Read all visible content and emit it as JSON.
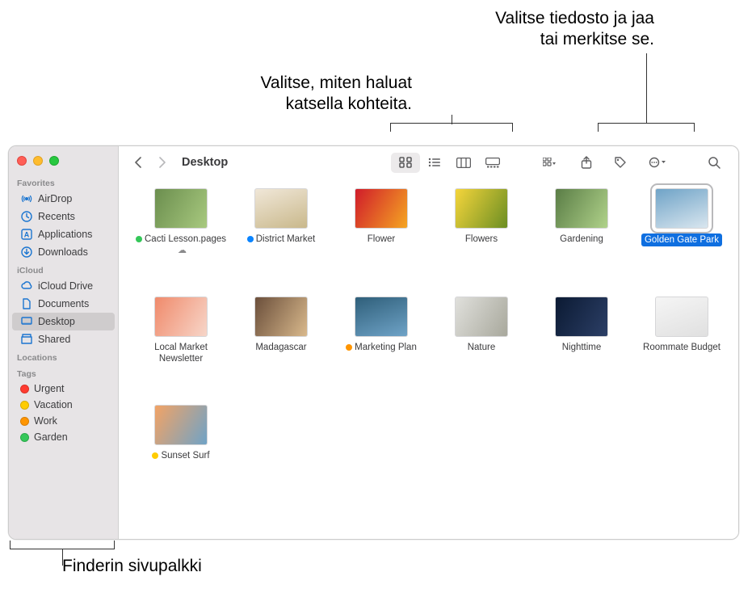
{
  "annotations": {
    "topRight1": "Valitse tiedosto ja jaa",
    "topRight2": "tai merkitse se.",
    "midLeft1": "Valitse, miten haluat",
    "midLeft2": "katsella kohteita.",
    "bottom": "Finderin sivupalkki"
  },
  "window": {
    "title": "Desktop"
  },
  "sidebar": {
    "sections": [
      {
        "header": "Favorites",
        "items": [
          {
            "label": "AirDrop",
            "icon": "airdrop"
          },
          {
            "label": "Recents",
            "icon": "clock"
          },
          {
            "label": "Applications",
            "icon": "apps"
          },
          {
            "label": "Downloads",
            "icon": "download"
          }
        ]
      },
      {
        "header": "iCloud",
        "items": [
          {
            "label": "iCloud Drive",
            "icon": "cloud"
          },
          {
            "label": "Documents",
            "icon": "doc"
          },
          {
            "label": "Desktop",
            "icon": "desktop",
            "selected": true
          },
          {
            "label": "Shared",
            "icon": "shared"
          }
        ]
      },
      {
        "header": "Locations",
        "items": []
      },
      {
        "header": "Tags",
        "items": [
          {
            "label": "Urgent",
            "color": "#ff3b30"
          },
          {
            "label": "Vacation",
            "color": "#ffcc00"
          },
          {
            "label": "Work",
            "color": "#ff9500"
          },
          {
            "label": "Garden",
            "color": "#34c759"
          }
        ]
      }
    ]
  },
  "files": [
    {
      "name": "Cacti Lesson.pages",
      "tag": "#34c759",
      "cloud": true,
      "thumb": "cacti"
    },
    {
      "name": "District Market",
      "tag": "#0a84ff",
      "thumb": "district"
    },
    {
      "name": "Flower",
      "thumb": "flower"
    },
    {
      "name": "Flowers",
      "thumb": "flowers"
    },
    {
      "name": "Gardening",
      "thumb": "gardening"
    },
    {
      "name": "Golden Gate Park",
      "selected": true,
      "thumb": "ggp"
    },
    {
      "name": "Local Market Newsletter",
      "thumb": "local"
    },
    {
      "name": "Madagascar",
      "thumb": "madagascar"
    },
    {
      "name": "Marketing Plan",
      "tag": "#ff9500",
      "thumb": "marketing"
    },
    {
      "name": "Nature",
      "thumb": "nature"
    },
    {
      "name": "Nighttime",
      "thumb": "night"
    },
    {
      "name": "Roommate Budget",
      "thumb": "budget"
    },
    {
      "name": "Sunset Surf",
      "tag": "#ffcc00",
      "thumb": "surf"
    }
  ],
  "thumbs": {
    "cacti": "linear-gradient(120deg,#6b8e4e,#a8c97f)",
    "district": "linear-gradient(160deg,#f0e7d8,#c9b88b)",
    "flower": "linear-gradient(120deg,#d01c2a,#f5a623)",
    "flowers": "linear-gradient(120deg,#f5d53b,#6b8e23)",
    "gardening": "linear-gradient(120deg,#5a7d46,#b0d28a)",
    "ggp": "linear-gradient(160deg,#6fa3c7,#d9e6ef)",
    "local": "linear-gradient(120deg,#f08a6b,#f7d6c9)",
    "madagascar": "linear-gradient(120deg,#6b4f3b,#d9b98c)",
    "marketing": "linear-gradient(160deg,#2f5f7a,#6fa3c7)",
    "nature": "linear-gradient(120deg,#e0e0dc,#a8a89c)",
    "night": "linear-gradient(120deg,#0b1a33,#2c3f66)",
    "budget": "linear-gradient(160deg,#f5f5f5,#e0e0e0)",
    "surf": "linear-gradient(120deg,#f2a365,#6fa3c7)"
  }
}
